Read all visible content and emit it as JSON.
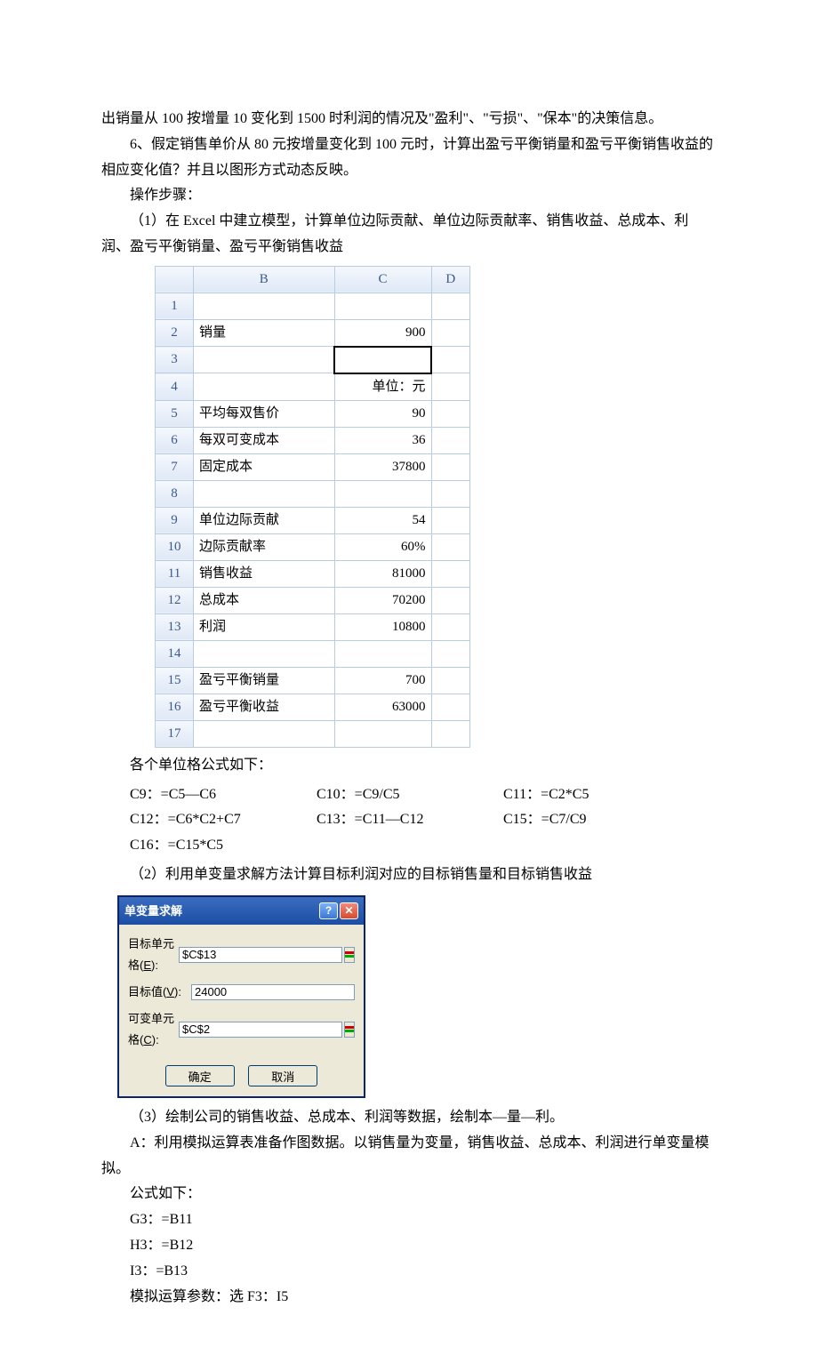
{
  "paragraphs": {
    "p1": "出销量从 100 按增量 10 变化到 1500 时利润的情况及\"盈利\"、\"亏损\"、\"保本\"的决策信息。",
    "p2": "6、假定销售单价从 80 元按增量变化到 100 元时，计算出盈亏平衡销量和盈亏平衡销售收益的相应变化值？并且以图形方式动态反映。",
    "p3": "操作步骤：",
    "p4": "（1）在 Excel 中建立模型，计算单位边际贡献、单位边际贡献率、销售收益、总成本、利润、盈亏平衡销量、盈亏平衡销售收益",
    "p5": "各个单位格公式如下：",
    "p6": "（2）利用单变量求解方法计算目标利润对应的目标销售量和目标销售收益",
    "p7": "（3）绘制公司的销售收益、总成本、利润等数据，绘制本—量—利。",
    "p8": "A：利用模拟运算表准备作图数据。以销售量为变量，销售收益、总成本、利润进行单变量模拟。",
    "p9": "公式如下：",
    "p10": "G3：=B11",
    "p11": "H3：=B12",
    "p12": "I3：=B13",
    "p13": "模拟运算参数：选 F3：I5"
  },
  "excel": {
    "headers": {
      "b": "B",
      "c": "C",
      "d": "D"
    },
    "rows": [
      {
        "n": "1",
        "b": "",
        "c": "",
        "d": ""
      },
      {
        "n": "2",
        "b": "销量",
        "c": "900",
        "d": ""
      },
      {
        "n": "3",
        "b": "",
        "c": "",
        "d": "",
        "selected": true
      },
      {
        "n": "4",
        "b": "",
        "c": "单位：元",
        "d": ""
      },
      {
        "n": "5",
        "b": "平均每双售价",
        "c": "90",
        "d": ""
      },
      {
        "n": "6",
        "b": "每双可变成本",
        "c": "36",
        "d": ""
      },
      {
        "n": "7",
        "b": "固定成本",
        "c": "37800",
        "d": ""
      },
      {
        "n": "8",
        "b": "",
        "c": "",
        "d": ""
      },
      {
        "n": "9",
        "b": "单位边际贡献",
        "c": "54",
        "d": ""
      },
      {
        "n": "10",
        "b": "边际贡献率",
        "c": "60%",
        "d": ""
      },
      {
        "n": "11",
        "b": "销售收益",
        "c": "81000",
        "d": ""
      },
      {
        "n": "12",
        "b": "总成本",
        "c": "70200",
        "d": ""
      },
      {
        "n": "13",
        "b": "利润",
        "c": "10800",
        "d": ""
      },
      {
        "n": "14",
        "b": "",
        "c": "",
        "d": ""
      },
      {
        "n": "15",
        "b": "盈亏平衡销量",
        "c": "700",
        "d": ""
      },
      {
        "n": "16",
        "b": "盈亏平衡收益",
        "c": "63000",
        "d": ""
      },
      {
        "n": "17",
        "b": "",
        "c": "",
        "d": ""
      }
    ]
  },
  "formulas": {
    "c9": "C9：=C5—C6",
    "c10": "C10：=C9/C5",
    "c11": "C11：=C2*C5",
    "c12": "C12：=C6*C2+C7",
    "c13": "C13：=C11—C12",
    "c15": "C15：=C7/C9",
    "c16": "C16：=C15*C5"
  },
  "dialog": {
    "title": "单变量求解",
    "labels": {
      "target_cell_prefix": "目标单元格(",
      "target_cell_key": "E",
      "target_cell_suffix": "):",
      "target_value_prefix": "目标值(",
      "target_value_key": "V",
      "target_value_suffix": "):",
      "changing_cell_prefix": "可变单元格(",
      "changing_cell_key": "C",
      "changing_cell_suffix": "):"
    },
    "values": {
      "target_cell": "$C$13",
      "target_value": "24000",
      "changing_cell": "$C$2"
    },
    "buttons": {
      "ok": "确定",
      "cancel": "取消"
    }
  }
}
